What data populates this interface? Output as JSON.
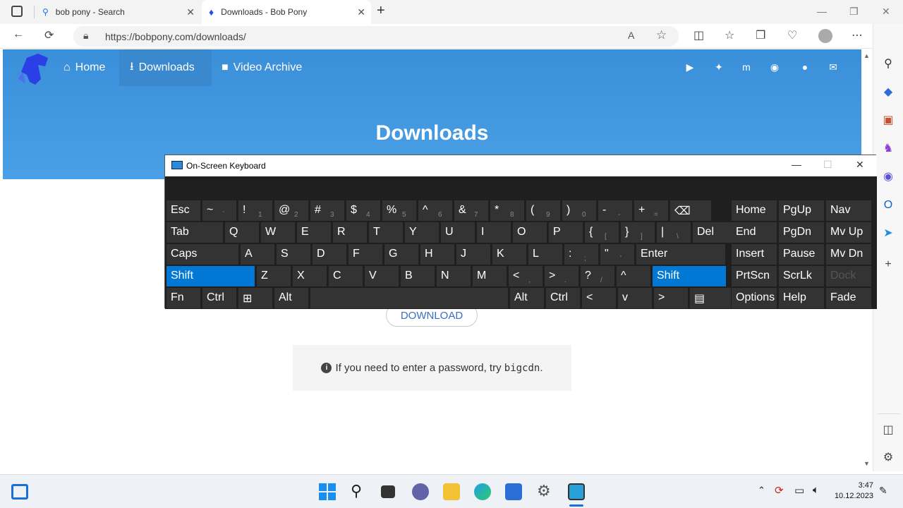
{
  "browser": {
    "tabs": [
      {
        "title": "bob pony - Search"
      },
      {
        "title": "Downloads - Bob Pony"
      }
    ],
    "url": "https://bobpony.com/downloads/"
  },
  "site": {
    "nav": [
      {
        "label": "Home"
      },
      {
        "label": "Downloads"
      },
      {
        "label": "Video Archive"
      }
    ],
    "title": "Downloads",
    "download_label": "DOWNLOAD",
    "note_prefix": "If you need to enter a password, try ",
    "note_code": "bigcdn",
    "note_suffix": "."
  },
  "osk": {
    "title": "On-Screen Keyboard",
    "rows": [
      [
        [
          "Esc",
          ""
        ],
        [
          "~",
          "`"
        ],
        [
          "!",
          "1"
        ],
        [
          "@",
          "2"
        ],
        [
          "#",
          "3"
        ],
        [
          "$",
          "4"
        ],
        [
          "%",
          "5"
        ],
        [
          "^",
          "6"
        ],
        [
          "&",
          "7"
        ],
        [
          "*",
          "8"
        ],
        [
          "(",
          "9"
        ],
        [
          ")",
          "0"
        ],
        [
          "-",
          "-"
        ],
        [
          "+",
          "="
        ],
        [
          "⌫",
          ""
        ],
        [
          "Home",
          ""
        ],
        [
          "PgUp",
          ""
        ],
        [
          "Nav",
          ""
        ]
      ],
      [
        [
          "Tab",
          ""
        ],
        [
          "Q",
          ""
        ],
        [
          "W",
          ""
        ],
        [
          "E",
          ""
        ],
        [
          "R",
          ""
        ],
        [
          "T",
          ""
        ],
        [
          "Y",
          ""
        ],
        [
          "U",
          ""
        ],
        [
          "I",
          ""
        ],
        [
          "O",
          ""
        ],
        [
          "P",
          ""
        ],
        [
          "{",
          "["
        ],
        [
          "}",
          "]"
        ],
        [
          "|",
          "\\"
        ],
        [
          "Del",
          ""
        ],
        [
          "End",
          ""
        ],
        [
          "PgDn",
          ""
        ],
        [
          "Mv Up",
          ""
        ]
      ],
      [
        [
          "Caps",
          ""
        ],
        [
          "A",
          ""
        ],
        [
          "S",
          ""
        ],
        [
          "D",
          ""
        ],
        [
          "F",
          ""
        ],
        [
          "G",
          ""
        ],
        [
          "H",
          ""
        ],
        [
          "J",
          ""
        ],
        [
          "K",
          ""
        ],
        [
          "L",
          ""
        ],
        [
          ":",
          ";"
        ],
        [
          "\"",
          "'"
        ],
        [
          "Enter",
          ""
        ],
        [
          "Insert",
          ""
        ],
        [
          "Pause",
          ""
        ],
        [
          "Mv Dn",
          ""
        ]
      ],
      [
        [
          "Shift",
          ""
        ],
        [
          "Z",
          ""
        ],
        [
          "X",
          ""
        ],
        [
          "C",
          ""
        ],
        [
          "V",
          ""
        ],
        [
          "B",
          ""
        ],
        [
          "N",
          ""
        ],
        [
          "M",
          ""
        ],
        [
          "<",
          ","
        ],
        [
          ">",
          "."
        ],
        [
          "?",
          "/"
        ],
        [
          "^",
          ""
        ],
        [
          "Shift",
          ""
        ],
        [
          "PrtScn",
          ""
        ],
        [
          "ScrLk",
          ""
        ],
        [
          "Dock",
          ""
        ]
      ],
      [
        [
          "Fn",
          ""
        ],
        [
          "Ctrl",
          ""
        ],
        [
          "⊞",
          ""
        ],
        [
          "Alt",
          ""
        ],
        [
          "",
          ""
        ],
        [
          "Alt",
          ""
        ],
        [
          "Ctrl",
          ""
        ],
        [
          "<",
          ""
        ],
        [
          "v",
          ""
        ],
        [
          ">",
          ""
        ],
        [
          "▤",
          ""
        ],
        [
          "Options",
          ""
        ],
        [
          "Help",
          ""
        ],
        [
          "Fade",
          ""
        ]
      ]
    ]
  },
  "taskbar": {
    "time": "3:47",
    "date": "10.12.2023"
  },
  "icons": [
    "search-icon",
    "home-icon",
    "download-icon",
    "video-icon",
    "youtube-icon",
    "twitter-icon",
    "mastodon-icon",
    "discord-icon",
    "github-icon",
    "email-icon",
    "info-icon"
  ]
}
